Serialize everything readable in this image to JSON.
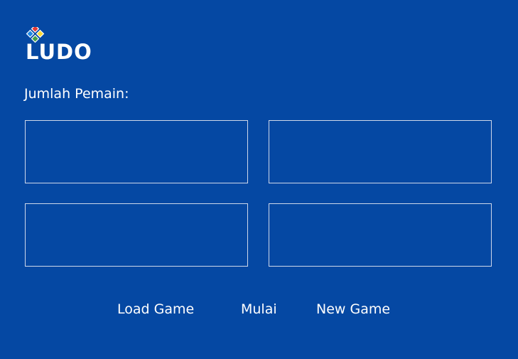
{
  "logo": {
    "text": "LUDO",
    "mark_colors": [
      "#E53935",
      "#43A047",
      "#FDD835",
      "#1E88E5"
    ]
  },
  "setup": {
    "heading": "Jumlah Pemain:",
    "player_slots": [
      {
        "label": ""
      },
      {
        "label": ""
      },
      {
        "label": ""
      },
      {
        "label": ""
      }
    ]
  },
  "actions": {
    "load_label": "Load Game",
    "start_label": "Mulai",
    "new_label": "New Game"
  },
  "colors": {
    "background": "#0548A3",
    "text": "#FFFFFF",
    "slot_border": "#CFD8EA"
  }
}
